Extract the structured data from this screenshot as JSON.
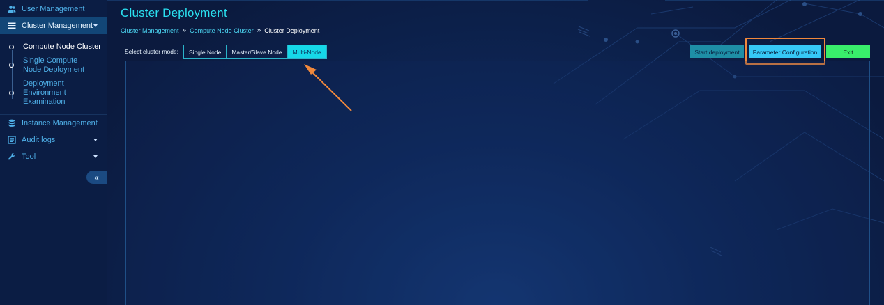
{
  "sidebar": {
    "items": [
      {
        "label": "User Management",
        "icon": "users-icon"
      },
      {
        "label": "Cluster Management",
        "icon": "list-icon"
      },
      {
        "label": "Instance Management",
        "icon": "database-icon"
      },
      {
        "label": "Audit logs",
        "icon": "document-icon"
      },
      {
        "label": "Tool",
        "icon": "wrench-icon"
      }
    ],
    "sub_items": [
      {
        "label": "Compute Node Cluster"
      },
      {
        "label": "Single Compute Node Deployment"
      },
      {
        "label": "Deployment Environment Examination"
      }
    ],
    "collapse_icon": "double-chevron-left-icon"
  },
  "header": {
    "title": "Cluster Deployment",
    "breadcrumb": [
      "Cluster Management",
      "Compute Node Cluster",
      "Cluster Deployment"
    ]
  },
  "mode": {
    "label": "Select cluster mode:",
    "options": [
      "Single Node",
      "Master/Slave Node",
      "Multi-Node"
    ],
    "selected": "Multi-Node"
  },
  "actions": {
    "start": "Start deployment",
    "param": "Parameter Configuration",
    "exit": "Exit"
  },
  "colors": {
    "accent": "#2ae0f0",
    "highlight": "#f0883c",
    "exit": "#39ee6b"
  }
}
